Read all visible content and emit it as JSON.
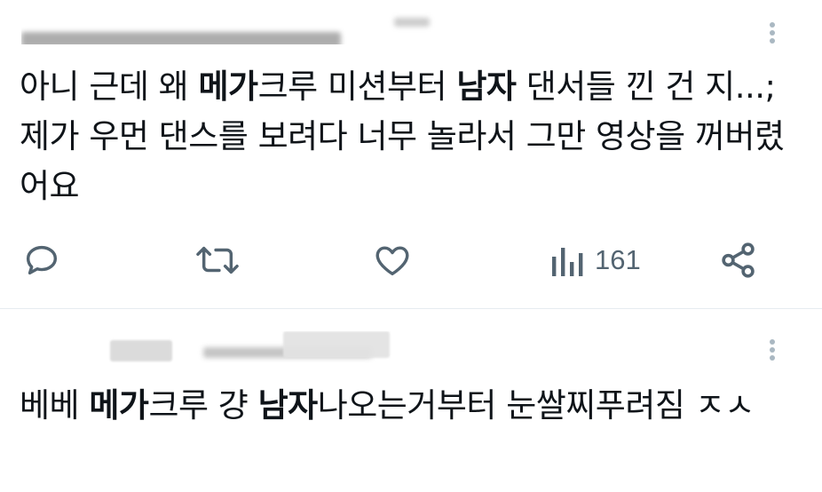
{
  "tweets": [
    {
      "body": {
        "p1": "아니 근데 왜 ",
        "b1": "메가",
        "p2": "크루 미션부터 ",
        "b2": "남자",
        "p3": " 댄서들 낀 건 지...; 제가 우먼 댄스를 보려다 너무 놀라서 그만 영상을 꺼버렸어요"
      },
      "actions": {
        "reply_icon": "reply-icon",
        "retweet_icon": "retweet-icon",
        "like_icon": "heart-icon",
        "views_icon": "views-icon",
        "views_count": "161",
        "share_icon": "share-icon"
      }
    },
    {
      "body": {
        "p1": "베베 ",
        "b1": "메가",
        "p2": "크루 걍 ",
        "b2": "남자",
        "p3": "나오는거부터 눈쌀찌푸려짐 ㅈㅅ"
      }
    }
  ],
  "colors": {
    "icon": "#536471",
    "divider": "#e6ecf0",
    "text": "#0f1419"
  }
}
